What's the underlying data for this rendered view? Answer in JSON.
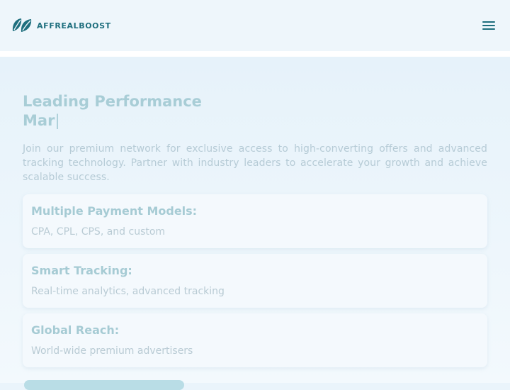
{
  "header": {
    "logo_text": "AFFREALBOOST",
    "logo_icon": "leaf-logo-icon",
    "menu_icon": "hamburger-menu-icon"
  },
  "hero": {
    "headline_line1": "Leading Performance",
    "headline_typed": "Mar",
    "cursor": "|",
    "intro": "Join our premium network for exclusive access to high-converting offers and advanced tracking technology. Partner with industry leaders to accelerate your growth and achieve scalable success."
  },
  "features": [
    {
      "title": "Multiple Payment Models:",
      "description": "CPA, CPL, CPS, and custom"
    },
    {
      "title": "Smart Tracking:",
      "description": "Real-time analytics, advanced tracking"
    },
    {
      "title": "Global Reach:",
      "description": "World-wide premium advertisers"
    }
  ],
  "colors": {
    "brand": "#1f6f7e",
    "headline": "#a8cdd6",
    "body_text": "#b6cbd6",
    "background": "#eaf4fb"
  }
}
